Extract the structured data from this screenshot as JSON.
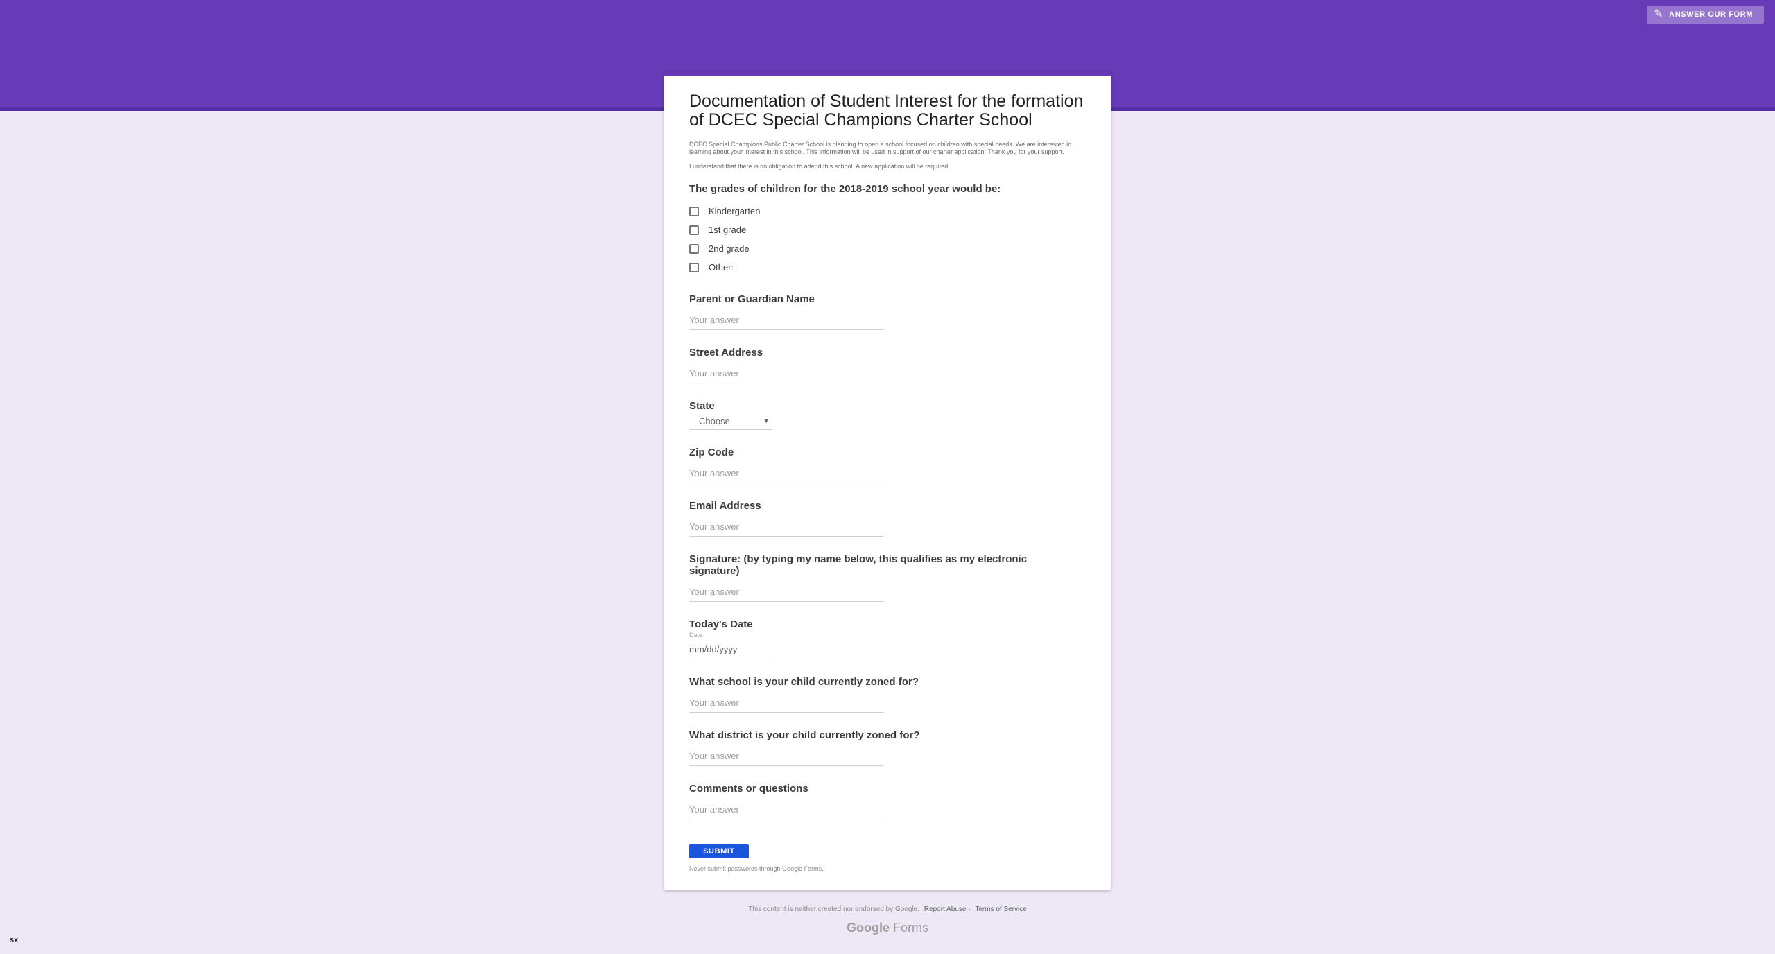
{
  "header": {
    "edit_link_label": "Answer our form",
    "edit_icon": "pencil-icon",
    "accent_color": "#673ab7"
  },
  "form": {
    "title": "Documentation of Student Interest for the formation of DCEC Special Champions Charter School",
    "description_1": "DCEC Special Champions Public Charter School is planning to open a school focused on children with special needs. We are interested in learning about your interest in this school. This information will be used in support of our charter application. Thank you for your support.",
    "description_2": "I understand that there is no obligation to attend this school. A new application will be required.",
    "grades_question": "The grades of children for the 2018-2019 school year would be:",
    "grade_options": [
      "Kindergarten",
      "1st grade",
      "2nd grade",
      "Other:"
    ],
    "answer_placeholder": "Your answer",
    "parent_name_label": "Parent or Guardian Name",
    "street_address_label": "Street Address",
    "state_label": "State",
    "state_value": "Choose",
    "zip_label": "Zip Code",
    "email_label": "Email Address",
    "signature_label": "Signature: (by typing my name below, this qualifies as my electronic signature)",
    "date_label": "Today's Date",
    "date_sublabel": "Date",
    "date_placeholder": "mm/dd/yyyy",
    "school_zone_label": "What school is your child currently zoned for?",
    "district_zone_label": "What district is your child currently zoned for?",
    "comments_label": "Comments or questions",
    "submit_label": "Submit",
    "never_submit_passwords": "Never submit passwords through Google Forms."
  },
  "footer": {
    "disclaimer": "This content is neither created nor endorsed by Google.",
    "report_abuse": "Report Abuse",
    "terms": "Terms of Service",
    "brand_google": "Google",
    "brand_forms": "Forms"
  },
  "corner_badge": "sx"
}
